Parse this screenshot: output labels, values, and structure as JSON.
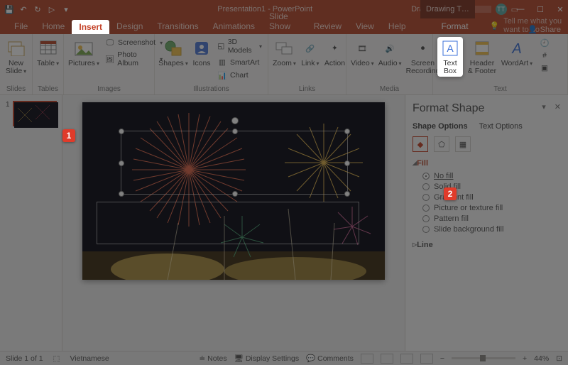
{
  "titlebar": {
    "doc_title": "Presentation1 - PowerPoint",
    "context_tab": "Drawing T…",
    "user_initials": "TT",
    "qat": {
      "save": "💾",
      "undo": "↶",
      "redo": "↻",
      "start": "▷",
      "more": "▾"
    }
  },
  "menu": {
    "tabs": [
      "File",
      "Home",
      "Insert",
      "Design",
      "Transitions",
      "Animations",
      "Slide Show",
      "Review",
      "View",
      "Help",
      "Format"
    ],
    "tellme": "Tell me what you want to do",
    "share": "Share"
  },
  "ribbon": {
    "groups": {
      "slides": {
        "label": "Slides",
        "new_slide": "New\nSlide"
      },
      "tables": {
        "label": "Tables",
        "table": "Table"
      },
      "images": {
        "label": "Images",
        "pictures": "Pictures",
        "screenshot": "Screenshot",
        "photo_album": "Photo Album"
      },
      "illustrations": {
        "label": "Illustrations",
        "shapes": "Shapes",
        "icons": "Icons",
        "models": "3D Models",
        "smartart": "SmartArt",
        "chart": "Chart"
      },
      "links": {
        "label": "Links",
        "zoom": "Zoom",
        "link": "Link",
        "action": "Action"
      },
      "media": {
        "label": "Media",
        "video": "Video",
        "audio": "Audio",
        "screen_rec": "Screen\nRecording"
      },
      "text": {
        "label": "Text",
        "text_box": "Text\nBox",
        "header_footer": "Header\n& Footer",
        "wordart": "WordArt"
      }
    }
  },
  "thumbs": {
    "num": "1"
  },
  "pane": {
    "title": "Format Shape",
    "tab1": "Shape Options",
    "tab2": "Text Options",
    "fill_label": "Fill",
    "line_label": "Line",
    "fill_options": [
      "No fill",
      "Solid fill",
      "Gradient fill",
      "Picture or texture fill",
      "Pattern fill",
      "Slide background fill"
    ]
  },
  "status": {
    "slide": "Slide 1 of 1",
    "lang": "Vietnamese",
    "notes": "Notes",
    "display": "Display Settings",
    "comments": "Comments",
    "zoom": "44%"
  },
  "callouts": {
    "c1": "1",
    "c2": "2"
  }
}
